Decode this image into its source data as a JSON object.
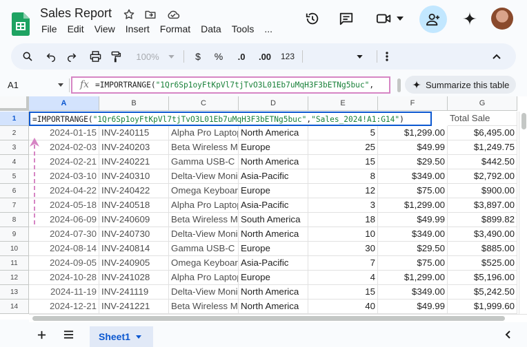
{
  "doc": {
    "title": "Sales Report",
    "menu": [
      "File",
      "Edit",
      "View",
      "Insert",
      "Format",
      "Data",
      "Tools",
      "..."
    ]
  },
  "toolbar": {
    "zoom": "100%",
    "currency": "$",
    "percent": "%",
    "dec_decrease": ".0",
    "dec_increase": ".00",
    "number_format": "123"
  },
  "formula_bar": {
    "name_box": "A1",
    "fx_label": "fx",
    "formula_prefix": "=IMPORTRANGE(",
    "formula_string": "\"1Qr6Sp1oyFtKpVl7tjTvO3L01Eb7uMqH3F3bETNg5buc\"",
    "formula_suffix": ",",
    "summarize_label": "Summarize this table"
  },
  "active_cell": {
    "prefix": "=IMPORTRANGE(",
    "arg1": "\"1Qr6Sp1oyFtKpVl7tjTvO3L01Eb7uMqH3F3bETNg5buc\"",
    "comma": ",",
    "arg2": "\"Sales_2024!A1:G14\"",
    "suffix": ")"
  },
  "grid": {
    "columns": [
      "A",
      "B",
      "C",
      "D",
      "E",
      "F",
      "G"
    ],
    "row_numbers": [
      "1",
      "2",
      "3",
      "4",
      "5",
      "6",
      "7",
      "8",
      "9",
      "10",
      "11",
      "12",
      "13",
      "14"
    ],
    "g1_header": "Total Sale",
    "rows": [
      [
        "2024-01-15",
        "INV-240115",
        "Alpha Pro Laptop",
        "North America",
        "5",
        "$1,299.00",
        "$6,495.00"
      ],
      [
        "2024-02-03",
        "INV-240203",
        "Beta Wireless M",
        "Europe",
        "25",
        "$49.99",
        "$1,249.75"
      ],
      [
        "2024-02-21",
        "INV-240221",
        "Gamma USB-C",
        "North America",
        "15",
        "$29.50",
        "$442.50"
      ],
      [
        "2024-03-10",
        "INV-240310",
        "Delta-View Moni",
        "Asia-Pacific",
        "8",
        "$349.00",
        "$2,792.00"
      ],
      [
        "2024-04-22",
        "INV-240422",
        "Omega Keyboar",
        "Europe",
        "12",
        "$75.00",
        "$900.00"
      ],
      [
        "2024-05-18",
        "INV-240518",
        "Alpha Pro Laptop",
        "Asia-Pacific",
        "3",
        "$1,299.00",
        "$3,897.00"
      ],
      [
        "2024-06-09",
        "INV-240609",
        "Beta Wireless M",
        "South America",
        "18",
        "$49.99",
        "$899.82"
      ],
      [
        "2024-07-30",
        "INV-240730",
        "Delta-View Moni",
        "North America",
        "10",
        "$349.00",
        "$3,490.00"
      ],
      [
        "2024-08-14",
        "INV-240814",
        "Gamma USB-C",
        "Europe",
        "30",
        "$29.50",
        "$885.00"
      ],
      [
        "2024-09-05",
        "INV-240905",
        "Omega Keyboar",
        "Asia-Pacific",
        "7",
        "$75.00",
        "$525.00"
      ],
      [
        "2024-10-28",
        "INV-241028",
        "Alpha Pro Laptop",
        "Europe",
        "4",
        "$1,299.00",
        "$5,196.00"
      ],
      [
        "2024-11-19",
        "INV-241119",
        "Delta-View Moni",
        "North America",
        "15",
        "$349.00",
        "$5,242.50"
      ],
      [
        "2024-12-21",
        "INV-241221",
        "Beta Wireless M",
        "North America",
        "40",
        "$49.99",
        "$1,999.60"
      ]
    ]
  },
  "sheets": {
    "active": "Sheet1"
  },
  "colors": {
    "selection_blue": "#0b57d0",
    "highlight_pink": "#d685c4",
    "formula_string_green": "#188038",
    "share_button": "#c2e7ff"
  },
  "icons": {
    "header": [
      "history-icon",
      "comment-icon",
      "video-icon",
      "add-person-icon",
      "gemini-icon"
    ],
    "toolbar": [
      "search-icon",
      "undo-icon",
      "redo-icon",
      "print-icon",
      "paint-format-icon",
      "more-vert-icon",
      "collapse-icon"
    ]
  }
}
